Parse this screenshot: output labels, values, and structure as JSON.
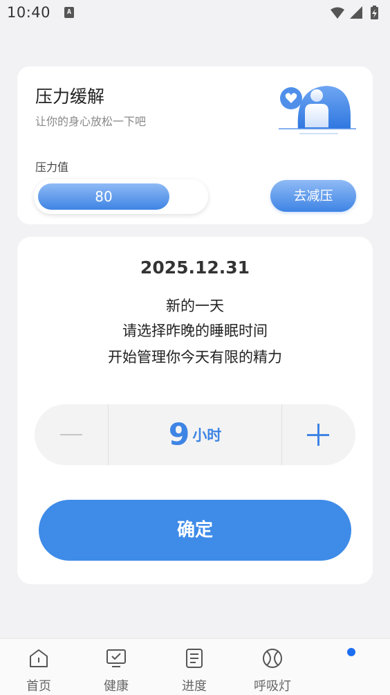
{
  "status_bar": {
    "time": "10:40",
    "notification_glyph": "A"
  },
  "stress_card": {
    "title": "压力缓解",
    "subtitle": "让你的身心放松一下吧",
    "stress_label": "压力值",
    "stress_value": "80",
    "stress_fraction": 0.8,
    "relieve_button": "去减压",
    "illustration": "person-heart-icon"
  },
  "sleep_card": {
    "date": "2025.12.31",
    "line1": "新的一天",
    "line2": "请选择昨晚的睡眠时间",
    "line3": "开始管理你今天有限的精力",
    "hours_value": "9",
    "hours_unit": "小时",
    "confirm_button": "确定"
  },
  "tab_bar": {
    "tabs": [
      {
        "label": "首页",
        "icon": "home-icon"
      },
      {
        "label": "健康",
        "icon": "monitor-check-icon"
      },
      {
        "label": "进度",
        "icon": "document-icon"
      },
      {
        "label": "呼吸灯",
        "icon": "ball-icon"
      }
    ]
  },
  "colors": {
    "accent": "#3e8be8",
    "background": "#f2f2f4",
    "badge": "#1e6ff0"
  }
}
